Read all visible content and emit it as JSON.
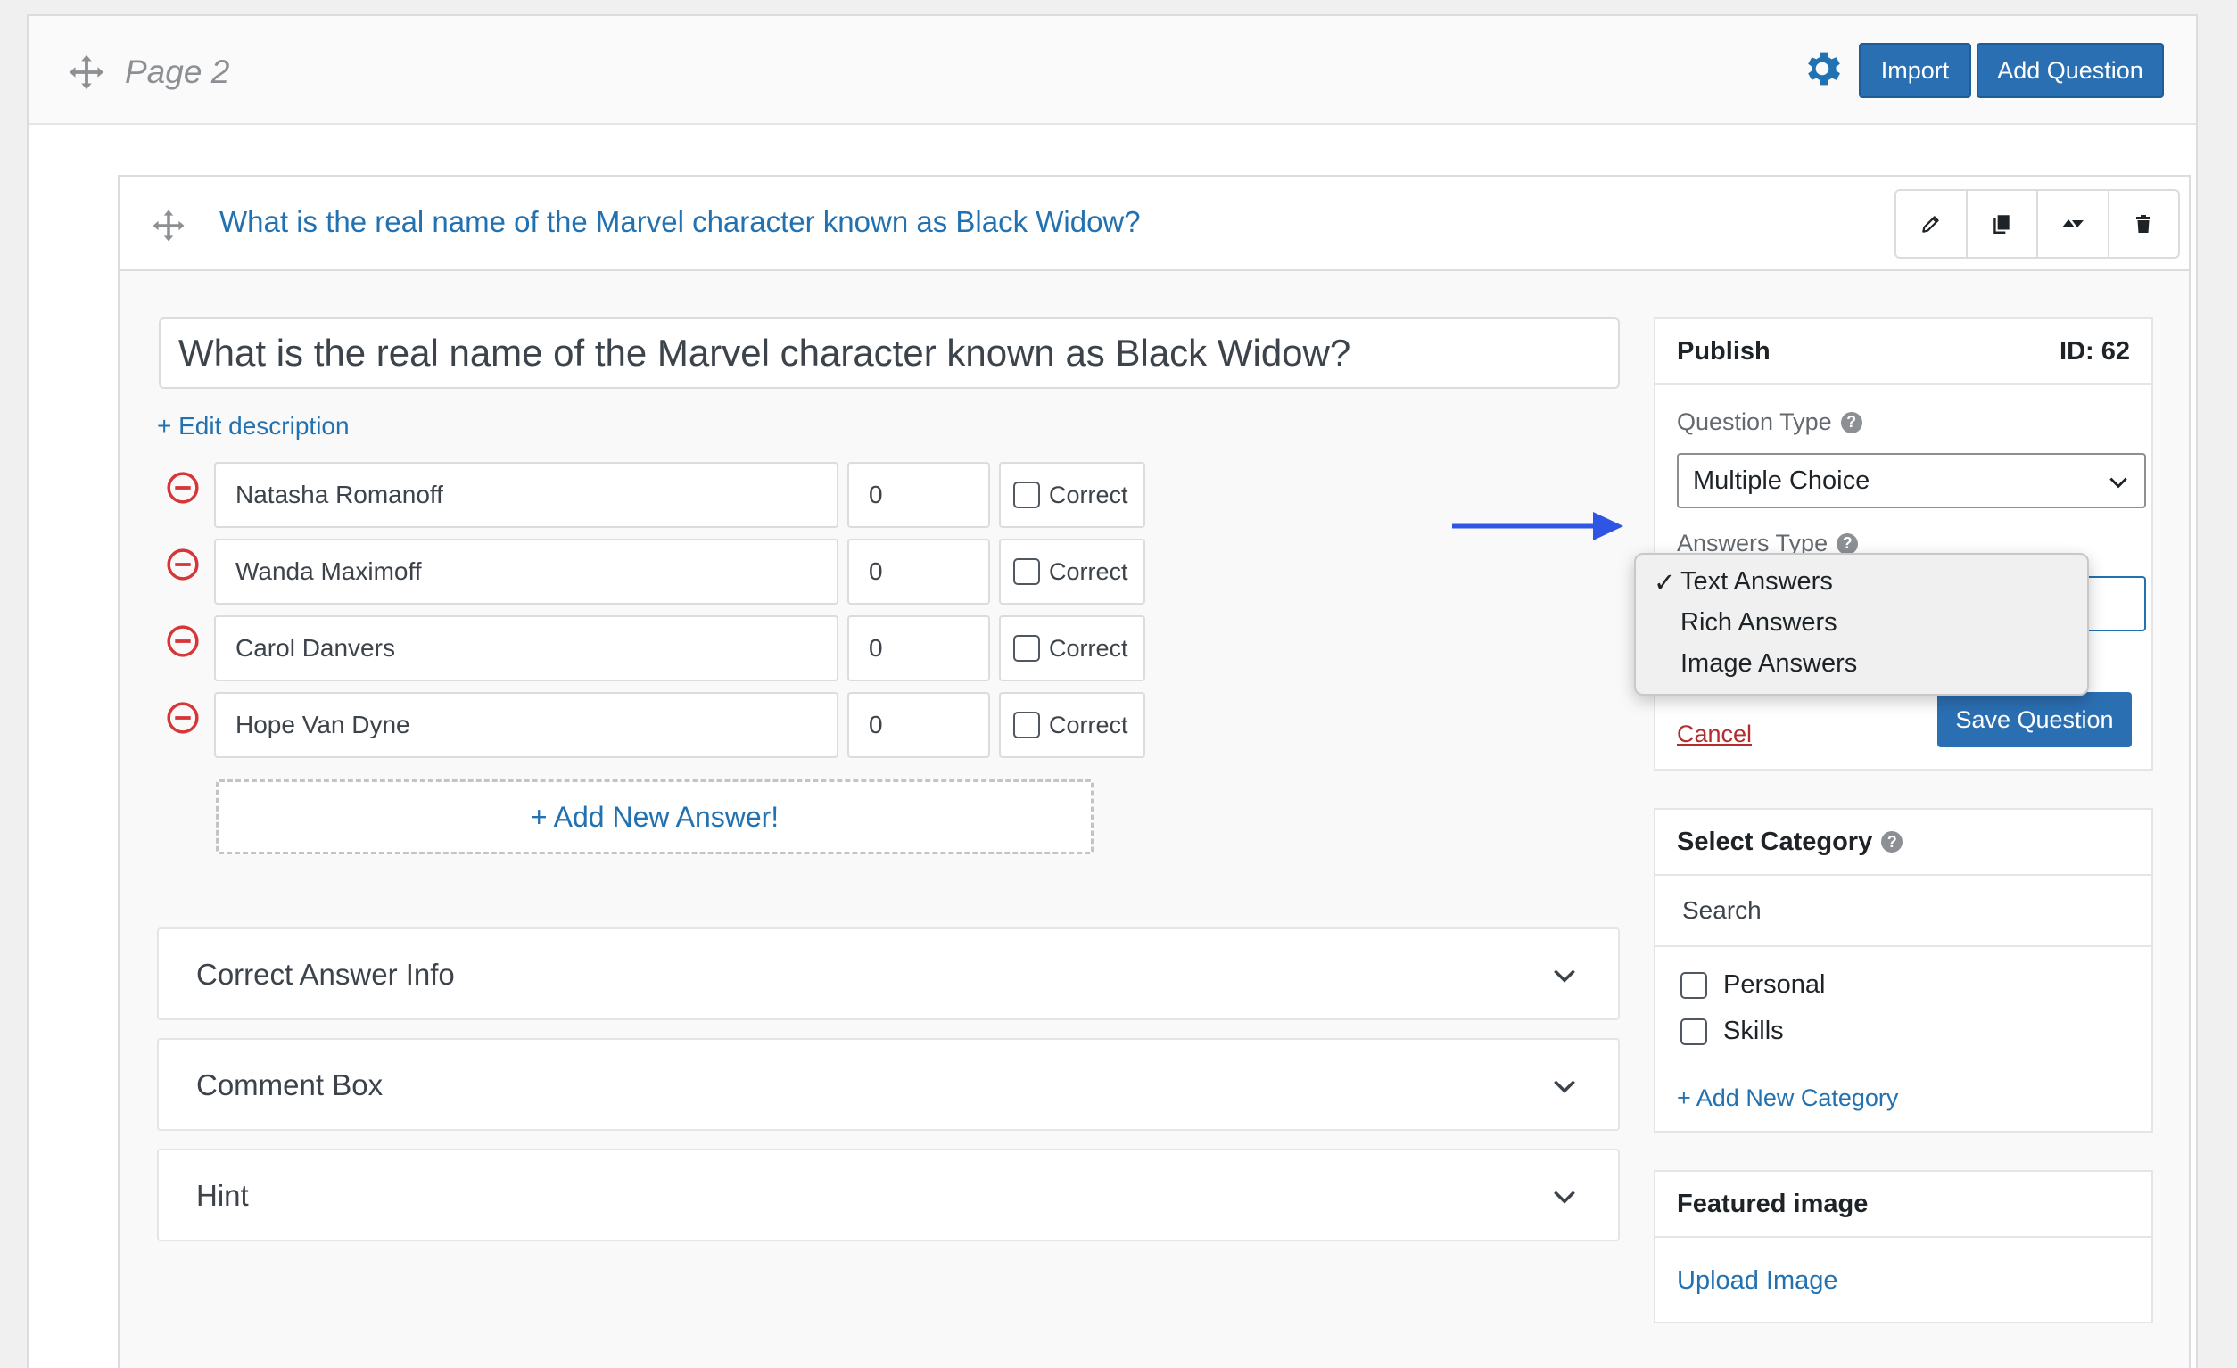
{
  "page": {
    "title": "Page 2",
    "import_label": "Import",
    "add_question_label": "Add Question"
  },
  "question": {
    "header_title": "What is the real name of the Marvel character known as Black Widow?",
    "title_value": "What is the real name of the Marvel character known as Black Widow?",
    "edit_description": "+ Edit description",
    "answers": [
      {
        "text": "Natasha Romanoff",
        "points": "0",
        "correct_label": "Correct",
        "checked": false
      },
      {
        "text": "Wanda Maximoff",
        "points": "0",
        "correct_label": "Correct",
        "checked": false
      },
      {
        "text": "Carol Danvers",
        "points": "0",
        "correct_label": "Correct",
        "checked": false
      },
      {
        "text": "Hope Van Dyne",
        "points": "0",
        "correct_label": "Correct",
        "checked": false
      }
    ],
    "add_answer_label": "+ Add New Answer!",
    "accordions": [
      "Correct Answer Info",
      "Comment Box",
      "Hint"
    ]
  },
  "publish": {
    "title": "Publish",
    "id_label": "ID: 62",
    "question_type_label": "Question Type",
    "question_type_value": "Multiple Choice",
    "answers_type_label": "Answers Type",
    "answers_type_options": [
      "Text Answers",
      "Rich Answers",
      "Image Answers"
    ],
    "answers_type_selected": "Text Answers",
    "check_mark": "✓",
    "cancel_label": "Cancel",
    "save_label": "Save Question"
  },
  "category": {
    "title": "Select Category",
    "search_placeholder": "Search",
    "items": [
      "Personal",
      "Skills"
    ],
    "add_label": "+ Add New Category"
  },
  "featured": {
    "title": "Featured image",
    "upload_label": "Upload Image"
  },
  "help_glyph": "?",
  "colors": {
    "primary": "#2b6fb3",
    "link": "#2271b1",
    "danger": "#d63638",
    "arrow": "#2f55e4"
  },
  "icons": {
    "move": "move-icon",
    "settings": "gear-icon",
    "edit": "pencil-icon",
    "duplicate": "copy-icon",
    "collapse": "collapse-icon",
    "delete": "trash-icon",
    "remove_answer": "minus-circle-icon",
    "expand": "chevron-down-icon"
  }
}
